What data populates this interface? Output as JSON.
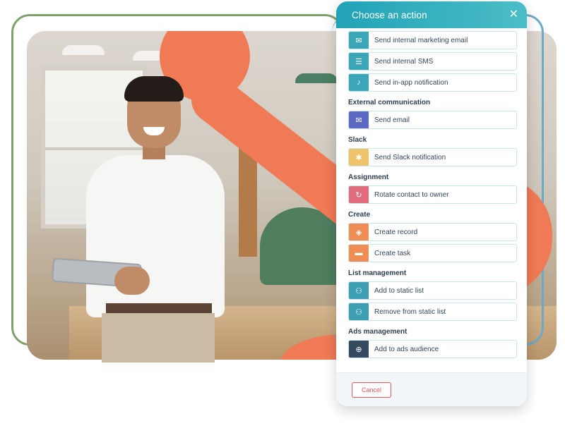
{
  "panel": {
    "title": "Choose an action",
    "close_icon": "close-icon",
    "cancel_label": "Cancel"
  },
  "colors": {
    "header": "#21a3b6",
    "teal_icon": "#3aa6b8",
    "email_icon": "#5c6ac4",
    "slack_icon": "#f0c36a",
    "assign_icon": "#e06c7c",
    "create_icon": "#f08d55",
    "list_icon": "#3e9fb3",
    "ads_icon": "#34495e",
    "accent": "#f07a55"
  },
  "sections": [
    {
      "heading": "",
      "actions": [
        {
          "label": "Send internal marketing email",
          "icon": "envelope-icon",
          "glyph": "✉"
        },
        {
          "label": "Send internal SMS",
          "icon": "chat-icon",
          "glyph": "☰"
        },
        {
          "label": "Send in-app notification",
          "icon": "bell-icon",
          "glyph": "♪"
        }
      ]
    },
    {
      "heading": "External communication",
      "actions": [
        {
          "label": "Send email",
          "icon": "envelope-icon",
          "glyph": "✉"
        }
      ]
    },
    {
      "heading": "Slack",
      "actions": [
        {
          "label": "Send Slack notification",
          "icon": "slack-icon",
          "glyph": "✱"
        }
      ]
    },
    {
      "heading": "Assignment",
      "actions": [
        {
          "label": "Rotate contact to owner",
          "icon": "rotate-icon",
          "glyph": "↻"
        }
      ]
    },
    {
      "heading": "Create",
      "actions": [
        {
          "label": "Create record",
          "icon": "cube-icon",
          "glyph": "◈"
        },
        {
          "label": "Create task",
          "icon": "task-icon",
          "glyph": "▬"
        }
      ]
    },
    {
      "heading": "List management",
      "actions": [
        {
          "label": "Add to static list",
          "icon": "people-icon",
          "glyph": "⚇"
        },
        {
          "label": "Remove from static list",
          "icon": "people-icon",
          "glyph": "⚇"
        }
      ]
    },
    {
      "heading": "Ads management",
      "actions": [
        {
          "label": "Add to ads audience",
          "icon": "target-icon",
          "glyph": "⊕"
        }
      ]
    }
  ]
}
